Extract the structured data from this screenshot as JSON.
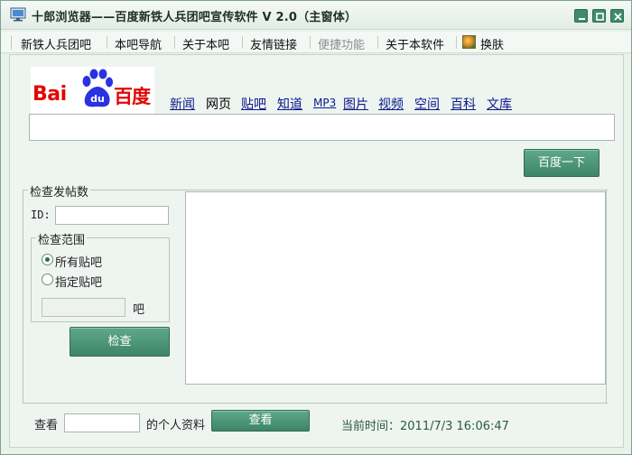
{
  "window": {
    "title": "十郎浏览器——百度新铁人兵团吧宣传软件 V 2.0（主窗体）",
    "icon": "monitor-icon"
  },
  "menu": {
    "items": [
      {
        "label": "新铁人兵团吧",
        "enabled": true
      },
      {
        "label": "本吧导航",
        "enabled": true
      },
      {
        "label": "关于本吧",
        "enabled": true
      },
      {
        "label": "友情链接",
        "enabled": true
      },
      {
        "label": "便捷功能",
        "enabled": false
      },
      {
        "label": "关于本软件",
        "enabled": true
      },
      {
        "label": "换肤",
        "enabled": true,
        "icon": "skin-icon"
      }
    ]
  },
  "baidu": {
    "logo_text_latin": "Bai",
    "logo_text_paw": "du",
    "logo_text_cn": "百度",
    "nav": [
      "新闻",
      "网页",
      "贴吧",
      "知道",
      "MP3",
      "图片",
      "视频",
      "空间",
      "百科",
      "文库"
    ],
    "active_nav": "网页",
    "search_value": "",
    "search_button": "百度一下"
  },
  "check_posts": {
    "group_title": "检查发帖数",
    "id_label": "ID:",
    "id_value": "",
    "scope_title": "检查范围",
    "options": [
      "所有贴吧",
      "指定贴吧"
    ],
    "selected_option": "所有贴吧",
    "bar_input_value": "",
    "bar_suffix": "吧",
    "check_button": "检查"
  },
  "result_text": "",
  "footer": {
    "view_label": "查看",
    "profile_value": "",
    "profile_suffix": "的个人资料",
    "view_button": "查看",
    "time_label": "当前时间：2011/7/3 16:06:47"
  },
  "colors": {
    "accent": "#3e8568",
    "baidu_red": "#e10602",
    "baidu_blue": "#2932e1",
    "link": "#0a1a8a"
  }
}
